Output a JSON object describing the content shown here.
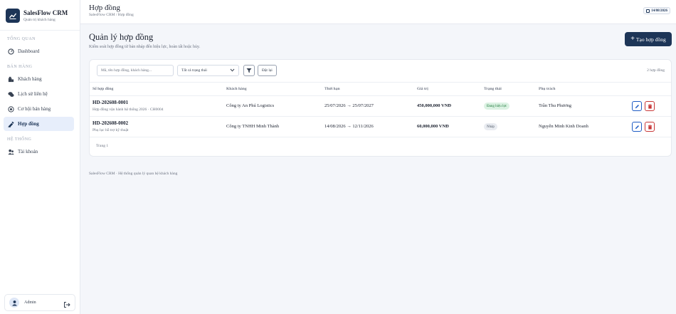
{
  "brand": {
    "name": "SalesFlow CRM",
    "subtitle": "Quản trị khách hàng"
  },
  "sidebar": {
    "sections": [
      {
        "label": "TỔNG QUAN"
      },
      {
        "label": "BÁN HÀNG"
      },
      {
        "label": "HỆ THỐNG"
      }
    ],
    "items": [
      {
        "label": "Dashboard",
        "icon": "dashboard-icon"
      },
      {
        "label": "Khách hàng",
        "icon": "building-icon"
      },
      {
        "label": "Lịch sử liên hệ",
        "icon": "chat-icon"
      },
      {
        "label": "Cơ hội bán hàng",
        "icon": "target-icon"
      },
      {
        "label": "Hợp đồng",
        "icon": "contract-icon",
        "active": true
      },
      {
        "label": "Tài khoản",
        "icon": "users-icon"
      }
    ],
    "user": {
      "name": "Admin"
    }
  },
  "topbar": {
    "title": "Hợp đồng",
    "breadcrumb": "SalesFlow CRM / Hợp đồng",
    "date": "14/08/2026"
  },
  "page": {
    "title": "Quản lý hợp đồng",
    "subtitle": "Kiểm soát hợp đồng từ bản nháp đến hiệu lực, hoàn tất hoặc hủy.",
    "create_label": "Tạo hợp đồng"
  },
  "filters": {
    "search_placeholder": "Mã, tên hợp đồng, khách hàng...",
    "status_selected": "Tất cả trạng thái",
    "reset_label": "Đặt lại",
    "count_label": "2 hợp đồng"
  },
  "table": {
    "columns": [
      "Số hợp đồng",
      "Khách hàng",
      "Thời hạn",
      "Giá trị",
      "Trạng thái",
      "Phụ trách"
    ],
    "rows": [
      {
        "code": "HD-202608-0001",
        "desc": "Hợp đồng vận hành hệ thống 2026 · CH0004",
        "customer": "Công ty An Phú Logistics",
        "period": "25/07/2026 → 25/07/2027",
        "value": "450,000,000 VNĐ",
        "status": "Đang hiệu lực",
        "status_color": "#dcf2e3",
        "owner": "Trần Thu Phương"
      },
      {
        "code": "HD-202608-0002",
        "desc": "Phụ lục hỗ trợ kỹ thuật",
        "customer": "Công ty TNHH Minh Thành",
        "period": "14/08/2026 → 12/11/2026",
        "value": "60,000,000 VNĐ",
        "status": "Nháp",
        "status_color": "#e9ecf1",
        "owner": "Nguyễn Minh Kinh Doanh"
      }
    ],
    "pager": "Trang 1"
  },
  "footer": "SalesFlow CRM · Hệ thống quản lý quan hệ khách hàng",
  "colors": {
    "primary": "#1d3557",
    "edit": "#1d5bc4",
    "delete": "#c83737"
  }
}
